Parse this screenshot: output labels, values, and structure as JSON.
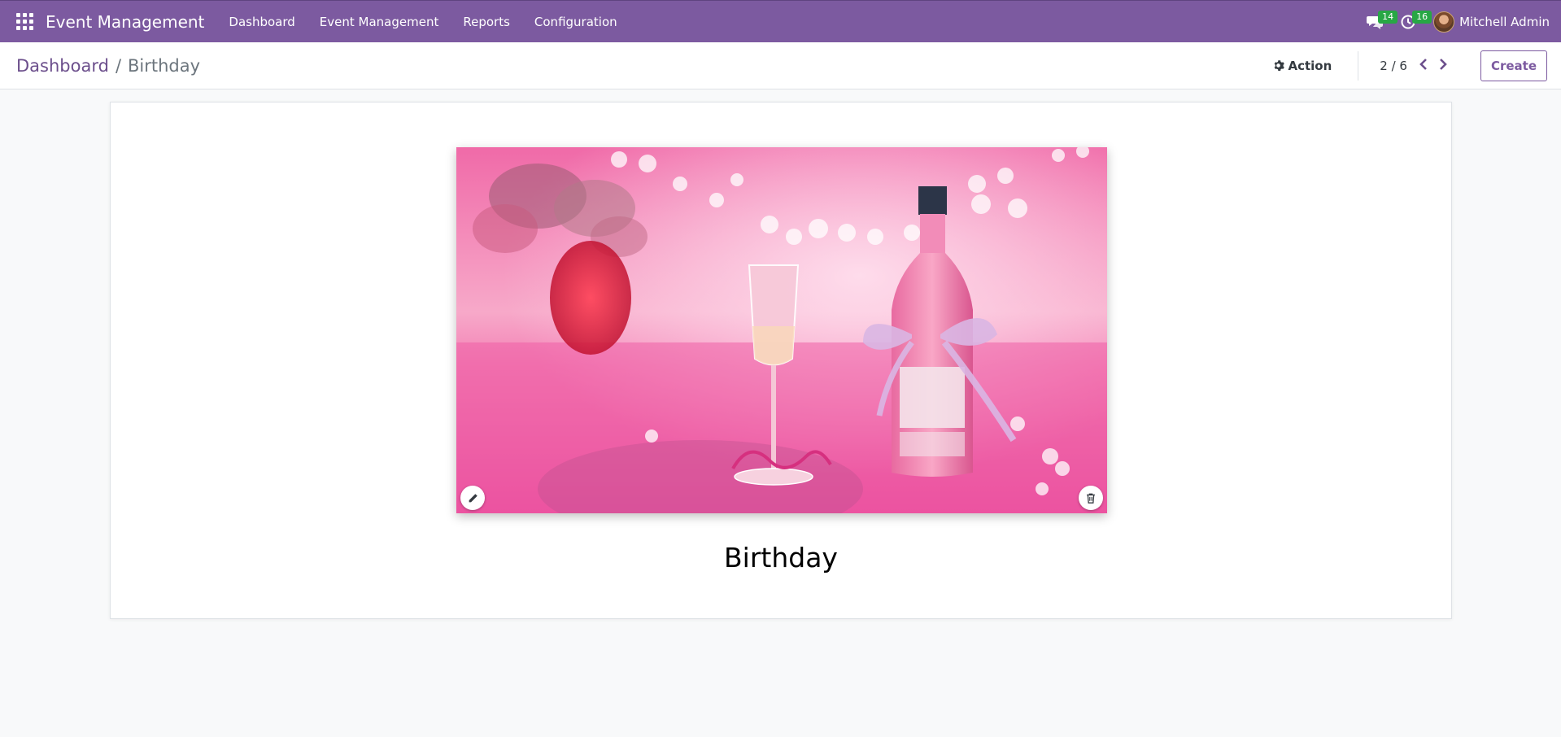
{
  "navbar": {
    "brand": "Event Management",
    "menu": [
      "Dashboard",
      "Event Management",
      "Reports",
      "Configuration"
    ],
    "messages_count": "14",
    "activities_count": "16",
    "user_name": "Mitchell Admin",
    "color": "#7c5aa0"
  },
  "breadcrumb": {
    "parent": "Dashboard",
    "separator": "/",
    "current": "Birthday"
  },
  "control": {
    "action_label": "Action",
    "pager": "2 / 6",
    "create_label": "Create"
  },
  "record": {
    "image_icons": [
      "pencil-icon",
      "trash-icon"
    ],
    "title": "Birthday"
  }
}
